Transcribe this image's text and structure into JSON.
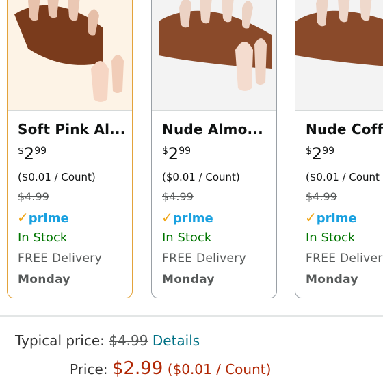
{
  "products": [
    {
      "title": "Soft Pink Al...",
      "price_symbol": "$",
      "price_whole": "2",
      "price_fraction": "99",
      "unit_price": "($0.01 / Count)",
      "list_price": "$4.99",
      "prime_label": "prime",
      "stock": "In Stock",
      "delivery": "FREE Delivery",
      "delivery_day": "Monday",
      "selected": true
    },
    {
      "title": "Nude Almo...",
      "price_symbol": "$",
      "price_whole": "2",
      "price_fraction": "99",
      "unit_price": "($0.01 / Count)",
      "list_price": "$4.99",
      "prime_label": "prime",
      "stock": "In Stock",
      "delivery": "FREE Delivery",
      "delivery_day": "Monday",
      "selected": false
    },
    {
      "title": "Nude Coffi",
      "price_symbol": "$",
      "price_whole": "2",
      "price_fraction": "99",
      "unit_price": "($0.01 / Count",
      "list_price": "$4.99",
      "prime_label": "prime",
      "stock": "In Stock",
      "delivery": "FREE Deliver",
      "delivery_day": "Monday",
      "selected": false
    }
  ],
  "price_details": {
    "typical_label": "Typical price:",
    "typical_value": "$4.99",
    "details_link": "Details",
    "price_label": "Price:",
    "price_value": "$2.99",
    "price_unit": "($0.01 / Count)"
  },
  "colors": {
    "price_red": "#b12704",
    "link_teal": "#007185",
    "stock_green": "#007600",
    "prime_blue": "#1aa1e0",
    "selected_border": "#e3a33b"
  }
}
